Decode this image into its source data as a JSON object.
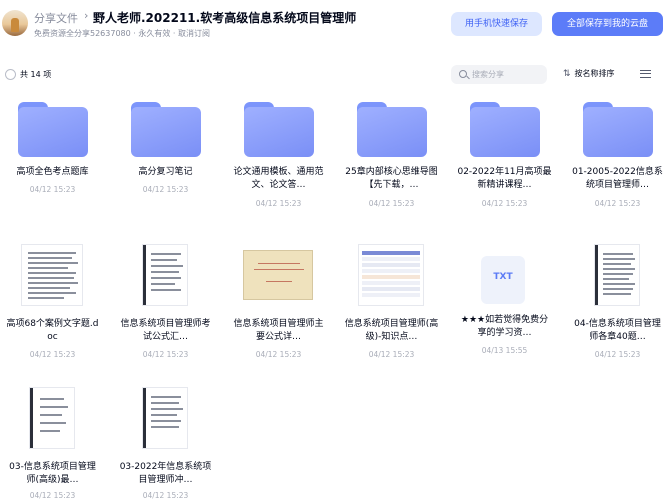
{
  "header": {
    "crumb": "分享文件",
    "crumb_sep": "›",
    "title": "野人老师.202211.软考高级信息系统项目管理师",
    "subtitle": "免费资源全分享52637080 · 永久有效 · 取消订阅",
    "btn_mobile": "用手机快速保存",
    "btn_save": "全部保存到我的云盘"
  },
  "toolbar": {
    "count": "共 14 项",
    "search_placeholder": "搜索分享",
    "sort_icon": "⇅",
    "sort_label": "按名称排序"
  },
  "files": [
    {
      "name": "高项全色考点题库",
      "date": "04/12 15:23",
      "kind": "folder"
    },
    {
      "name": "高分复习笔记",
      "date": "04/12 15:23",
      "kind": "folder"
    },
    {
      "name": "论文通用模板、通用范文、论文答…",
      "date": "04/12 15:23",
      "kind": "folder"
    },
    {
      "name": "25章内部核心思维导图【先下载，…",
      "date": "04/12 15:23",
      "kind": "folder"
    },
    {
      "name": "02-2022年11月高项最新精讲课程…",
      "date": "04/12 15:23",
      "kind": "folder"
    },
    {
      "name": "01-2005-2022信息系统项目管理师…",
      "date": "04/12 15:23",
      "kind": "folder"
    },
    {
      "name": "高项68个案例文字题.doc",
      "date": "04/12 15:23",
      "kind": "doc"
    },
    {
      "name": "信息系统项目管理师考试公式汇…",
      "date": "04/12 15:23",
      "kind": "pdf"
    },
    {
      "name": "信息系统项目管理师主要公式详…",
      "date": "04/12 15:23",
      "kind": "ppt"
    },
    {
      "name": "信息系统项目管理师(高级)-知识点…",
      "date": "04/12 15:23",
      "kind": "sheet"
    },
    {
      "name": "★★★如若觉得免费分享的学习资…",
      "date": "04/13 15:55",
      "kind": "txt"
    },
    {
      "name": "04-信息系统项目管理师各章40题…",
      "date": "04/12 15:23",
      "kind": "pdf"
    },
    {
      "name": "03-信息系统项目管理师(高级)最…",
      "date": "04/12 15:23",
      "kind": "pdf"
    },
    {
      "name": "03-2022年信息系统项目管理师冲…",
      "date": "04/12 15:23",
      "kind": "pdf"
    }
  ],
  "txt_label": "TXT",
  "colors": {
    "accent": "#5c7cf8",
    "folder": "#8ea0fb",
    "muted": "#878c9c"
  }
}
